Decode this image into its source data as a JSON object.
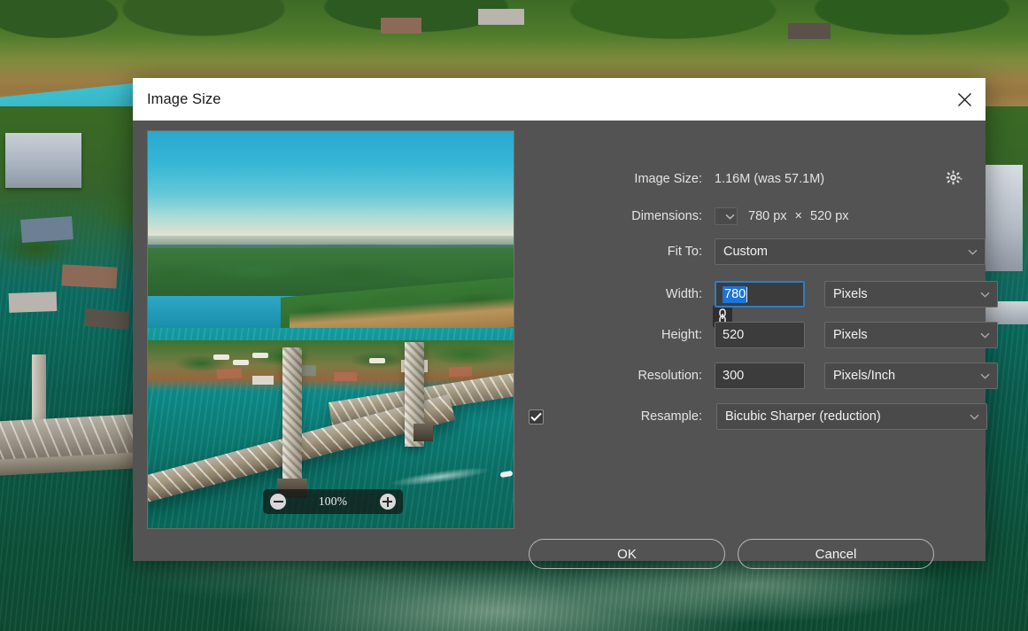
{
  "dialog": {
    "title": "Image Size",
    "close_icon": "close-icon"
  },
  "info": {
    "image_size_label": "Image Size:",
    "image_size_value": "1.16M (was 57.1M)",
    "gear_icon": "gear-icon",
    "dimensions_label": "Dimensions:",
    "dimensions_width": "780 px",
    "dimensions_sep": "×",
    "dimensions_height": "520 px",
    "dimensions_dropdown_icon": "chevron-down-icon"
  },
  "fields": {
    "fit_to_label": "Fit To:",
    "fit_to_value": "Custom",
    "width_label": "Width:",
    "width_value": "780",
    "width_unit": "Pixels",
    "height_label": "Height:",
    "height_value": "520",
    "height_unit": "Pixels",
    "resolution_label": "Resolution:",
    "resolution_value": "300",
    "resolution_unit": "Pixels/Inch",
    "resample_label": "Resample:",
    "resample_value": "Bicubic Sharper (reduction)",
    "resample_checked": true,
    "constrain_icon": "chain-link-icon"
  },
  "preview": {
    "zoom_level": "100%",
    "zoom_out_icon": "minus-circle-icon",
    "zoom_in_icon": "plus-circle-icon"
  },
  "buttons": {
    "ok": "OK",
    "cancel": "Cancel"
  },
  "colors": {
    "dialog_bg": "#535353",
    "titlebar_bg": "#ffffff",
    "field_bg": "#3c3c3c",
    "select_bg": "#4a4a4a",
    "focus_border": "#2d7ec7",
    "selection_blue": "#1e74d6",
    "text": "#e3e3e3"
  }
}
